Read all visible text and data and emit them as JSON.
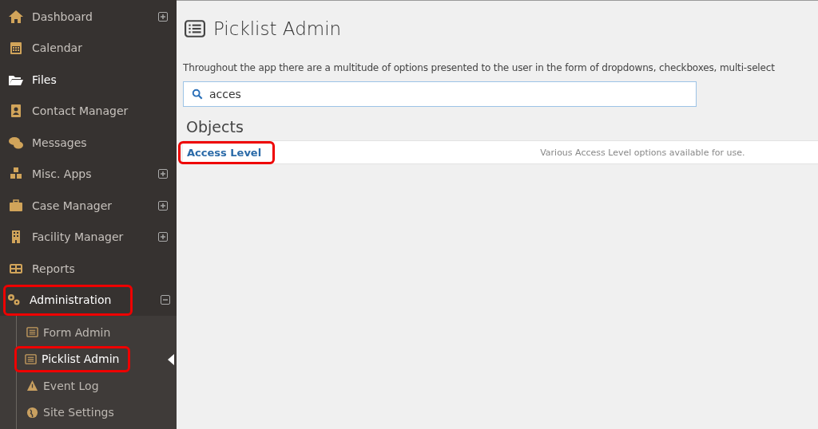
{
  "sidebar": {
    "items": [
      {
        "label": "Dashboard",
        "active": false,
        "expanded": false,
        "highlighted": false
      },
      {
        "label": "Calendar",
        "active": false,
        "highlighted": false
      },
      {
        "label": "Files",
        "active": true,
        "highlighted": false
      },
      {
        "label": "Contact Manager",
        "active": false,
        "highlighted": false
      },
      {
        "label": "Messages",
        "active": false,
        "highlighted": false
      },
      {
        "label": "Misc. Apps",
        "active": false,
        "expanded": false,
        "highlighted": false
      },
      {
        "label": "Case Manager",
        "active": false,
        "expanded": false,
        "highlighted": false
      },
      {
        "label": "Facility Manager",
        "active": false,
        "expanded": false,
        "highlighted": false
      },
      {
        "label": "Reports",
        "active": false,
        "highlighted": false
      },
      {
        "label": "Administration",
        "active": true,
        "expanded": true,
        "highlighted": true,
        "children": [
          {
            "label": "Form Admin",
            "selected": false,
            "highlighted": false
          },
          {
            "label": "Picklist Admin",
            "selected": true,
            "highlighted": true
          },
          {
            "label": "Event Log",
            "selected": false,
            "highlighted": false
          },
          {
            "label": "Site Settings",
            "selected": false,
            "highlighted": false
          }
        ]
      }
    ]
  },
  "page": {
    "title": "Picklist Admin",
    "description": "Throughout the app there are a multitude of options presented to the user in the form of dropdowns, checkboxes, multi-select",
    "search": {
      "value": "acces"
    },
    "section_title": "Objects",
    "results": [
      {
        "name": "Access Level",
        "description": "Various Access Level options available for use.",
        "highlighted": true
      }
    ]
  }
}
